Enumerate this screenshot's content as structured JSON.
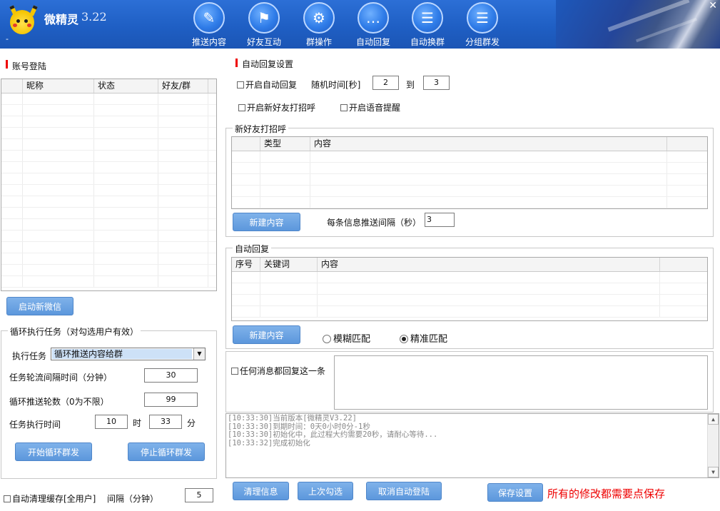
{
  "app": {
    "title": "微精灵",
    "version": "3.22",
    "dash": "-",
    "close": "✕"
  },
  "nav": {
    "items": [
      {
        "label": "推送内容",
        "icon": "pen-icon"
      },
      {
        "label": "好友互动",
        "icon": "contact-flag-icon"
      },
      {
        "label": "群操作",
        "icon": "gear-icon"
      },
      {
        "label": "自动回复",
        "icon": "chat-bubble-icon"
      },
      {
        "label": "自动换群",
        "icon": "message-icon"
      },
      {
        "label": "分组群发",
        "icon": "message-icon"
      }
    ]
  },
  "account": {
    "section_title": "账号登陆",
    "columns": [
      "昵称",
      "状态",
      "好友/群"
    ],
    "start_button": "启动新微信"
  },
  "loop": {
    "group_title": "循环执行任务（对勾选用户有效）",
    "task_label": "执行任务",
    "task_value": "循环推送内容给群",
    "interval_label": "任务轮流间隔时间（分钟）",
    "interval_value": "30",
    "rounds_label": "循环推送轮数（0为不限）",
    "rounds_value": "99",
    "time_label": "任务执行时间",
    "hour_value": "10",
    "hour_unit": "时",
    "minute_value": "33",
    "minute_unit": "分",
    "start_button": "开始循环群发",
    "stop_button": "停止循环群发"
  },
  "cache": {
    "label": "自动清理缓存[全用户]",
    "interval_label": "间隔（分钟）",
    "interval_value": "5"
  },
  "auto_reply_settings": {
    "section_title": "自动回复设置",
    "enable_label": "开启自动回复",
    "random_time_label": "随机时间[秒]",
    "from_value": "2",
    "to_label": "到",
    "to_value": "3",
    "greet_label": "开启新好友打招呼",
    "voice_label": "开启语音提醒"
  },
  "greeting": {
    "group_title": "新好友打招呼",
    "columns": [
      "类型",
      "内容"
    ],
    "new_button": "新建内容",
    "push_interval_label": "每条信息推送间隔（秒）",
    "push_interval_value": "3"
  },
  "auto_reply": {
    "group_title": "自动回复",
    "columns": [
      "序号",
      "关键词",
      "内容"
    ],
    "new_button": "新建内容",
    "fuzzy_label": "模糊匹配",
    "exact_label": "精准匹配",
    "selected": "exact"
  },
  "any_message": {
    "label": "任何消息都回复这一条"
  },
  "log": {
    "lines": [
      "[10:33:30]当前版本[微精灵V3.22]",
      "[10:33:30]到期时间：0天0小时0分-1秒",
      "[10:33:30]初始化中，此过程大约需要20秒，请耐心等待...",
      "[10:33:32]完成初始化"
    ]
  },
  "footer": {
    "clear_button": "清理信息",
    "last_check_button": "上次勾选",
    "cancel_login_button": "取消自动登陆",
    "save_button": "保存设置",
    "save_hint": "所有的修改都需要点保存"
  },
  "colors": {
    "banner": "#2c6fd6",
    "button": "#5c97dc",
    "accent_red": "#e00000"
  }
}
